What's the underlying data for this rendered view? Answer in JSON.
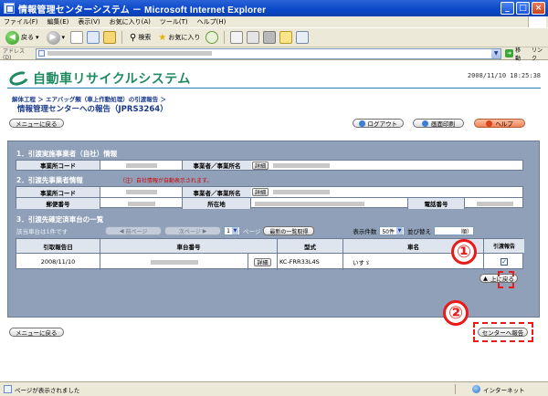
{
  "window": {
    "title": "情報管理センターシステム － Microsoft Internet Explorer"
  },
  "menubar": {
    "items": [
      "ファイル(F)",
      "編集(E)",
      "表示(V)",
      "お気に入り(A)",
      "ツール(T)",
      "ヘルプ(H)"
    ]
  },
  "toolbar": {
    "back": "戻る",
    "search": "検索",
    "favorites": "お気に入り"
  },
  "addressbar": {
    "label": "アドレス(D)",
    "go": "移動",
    "links": "リンク"
  },
  "page": {
    "brand": "自動車リサイクルシステム",
    "datetime": "2008/11/10 18:25:38",
    "breadcrumb": "解体工程 ＞ エアバッグ類（車上作動処理）の引渡報告 ＞",
    "title": "情報管理センターへの報告（JPRS3264）"
  },
  "buttons": {
    "menu_back": "メニューに戻る",
    "logout": "ログアウト",
    "print": "画面印刷",
    "help": "ヘルプ",
    "detail": "詳細",
    "to_top": "上に戻る",
    "report": "センターへ報告"
  },
  "section1": {
    "heading": "1．引渡実施事業者（自社）情報",
    "office_code": "事業所コード",
    "business_name": "事業者／事業所名"
  },
  "section2": {
    "heading": "2．引渡先事業者情報",
    "note": "（注）自社情報が自動表示されます。",
    "office_code": "事業所コード",
    "business_name": "事業者／事業所名",
    "postal": "郵便番号",
    "address": "所在地",
    "phone": "電話番号"
  },
  "section3": {
    "heading": "3．引渡先確定済車台の一覧",
    "count": "該当車台は1件です",
    "prev": "前ページ",
    "next": "次ページ",
    "page_num": "1",
    "page_unit": "ページ",
    "latest": "最新の一覧取得",
    "display_count_label": "表示件数",
    "display_count": "50件",
    "sort_label": "並び替え",
    "sort_tail": "順）",
    "columns": {
      "report_date": "引取報告日",
      "chassis": "車台番号",
      "model": "型式",
      "maker": "車名",
      "report_flag": "引渡報告"
    },
    "row": {
      "date": "2008/11/10",
      "model": "KC-FRR33L4S",
      "maker": "いすゞ"
    }
  },
  "callouts": {
    "one": "①",
    "two": "②"
  },
  "status": {
    "text": "ページが表示されました",
    "zone": "インターネット"
  }
}
